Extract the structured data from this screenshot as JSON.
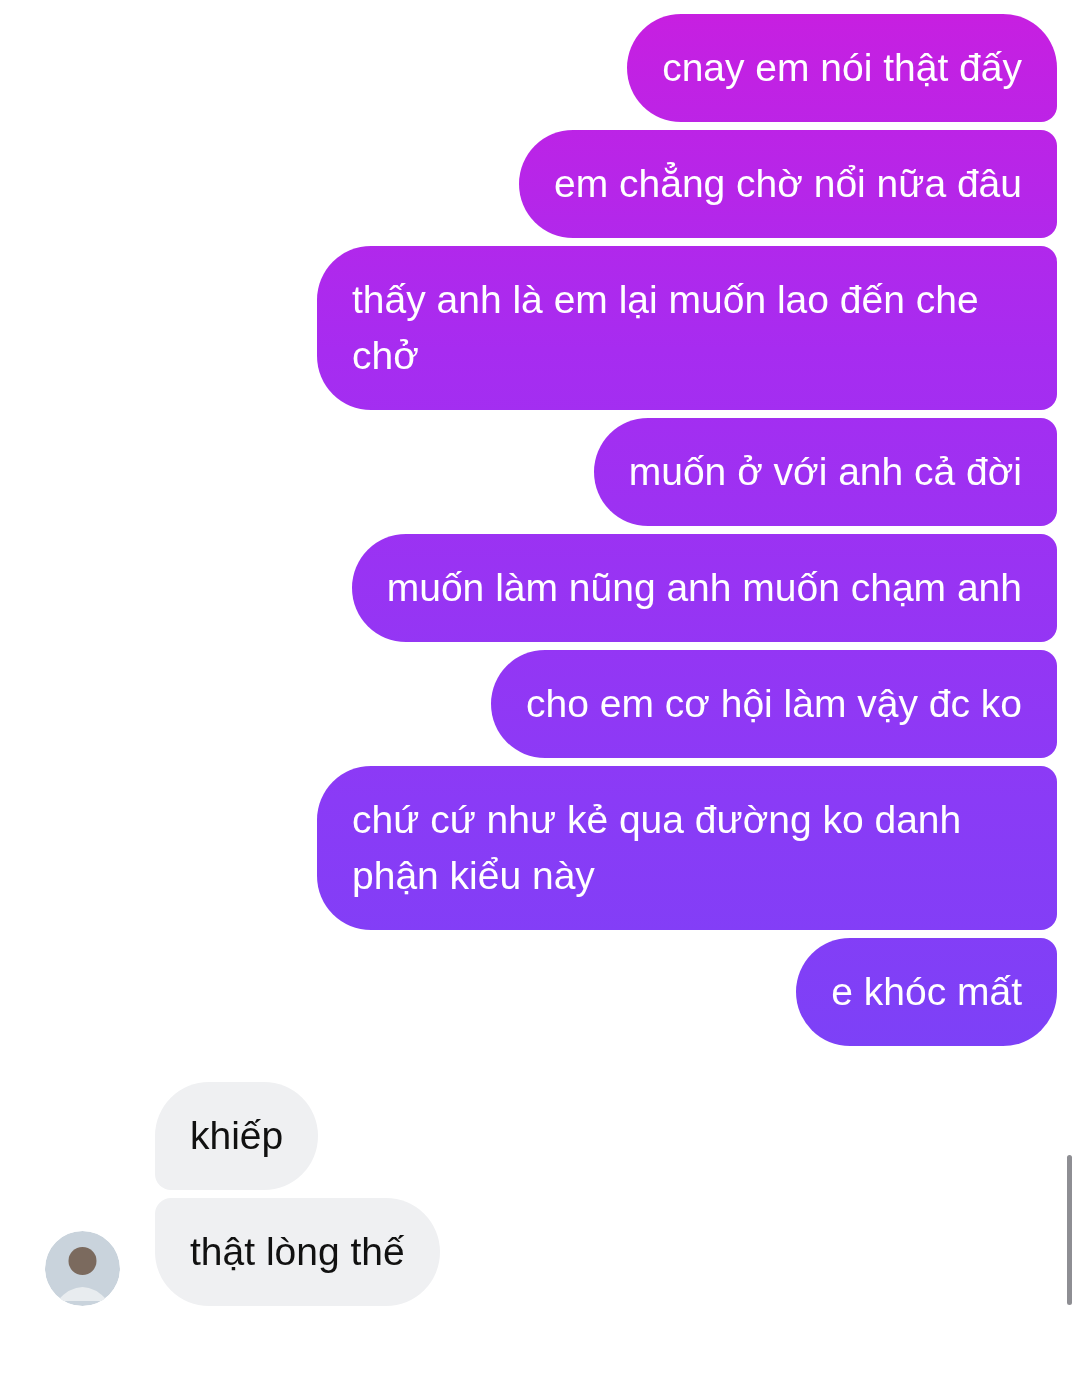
{
  "messages": [
    {
      "kind": "sent",
      "text": "cnay em nói thật đấy"
    },
    {
      "kind": "sent",
      "text": "em chẳng chờ nổi nữa đâu"
    },
    {
      "kind": "sent",
      "text": "thấy anh là em lại muốn lao đến che chở"
    },
    {
      "kind": "sent",
      "text": "muốn ở với anh cả đời"
    },
    {
      "kind": "sent",
      "text": "muốn làm nũng anh muốn chạm anh"
    },
    {
      "kind": "sent",
      "text": "cho em cơ hội làm vậy đc ko"
    },
    {
      "kind": "sent",
      "text": "chứ cứ như kẻ qua đường ko danh phận kiểu này"
    },
    {
      "kind": "sent",
      "text": "e khóc mất"
    },
    {
      "kind": "received",
      "text": "khiếp"
    },
    {
      "kind": "received",
      "text": "thật lòng thế"
    }
  ]
}
